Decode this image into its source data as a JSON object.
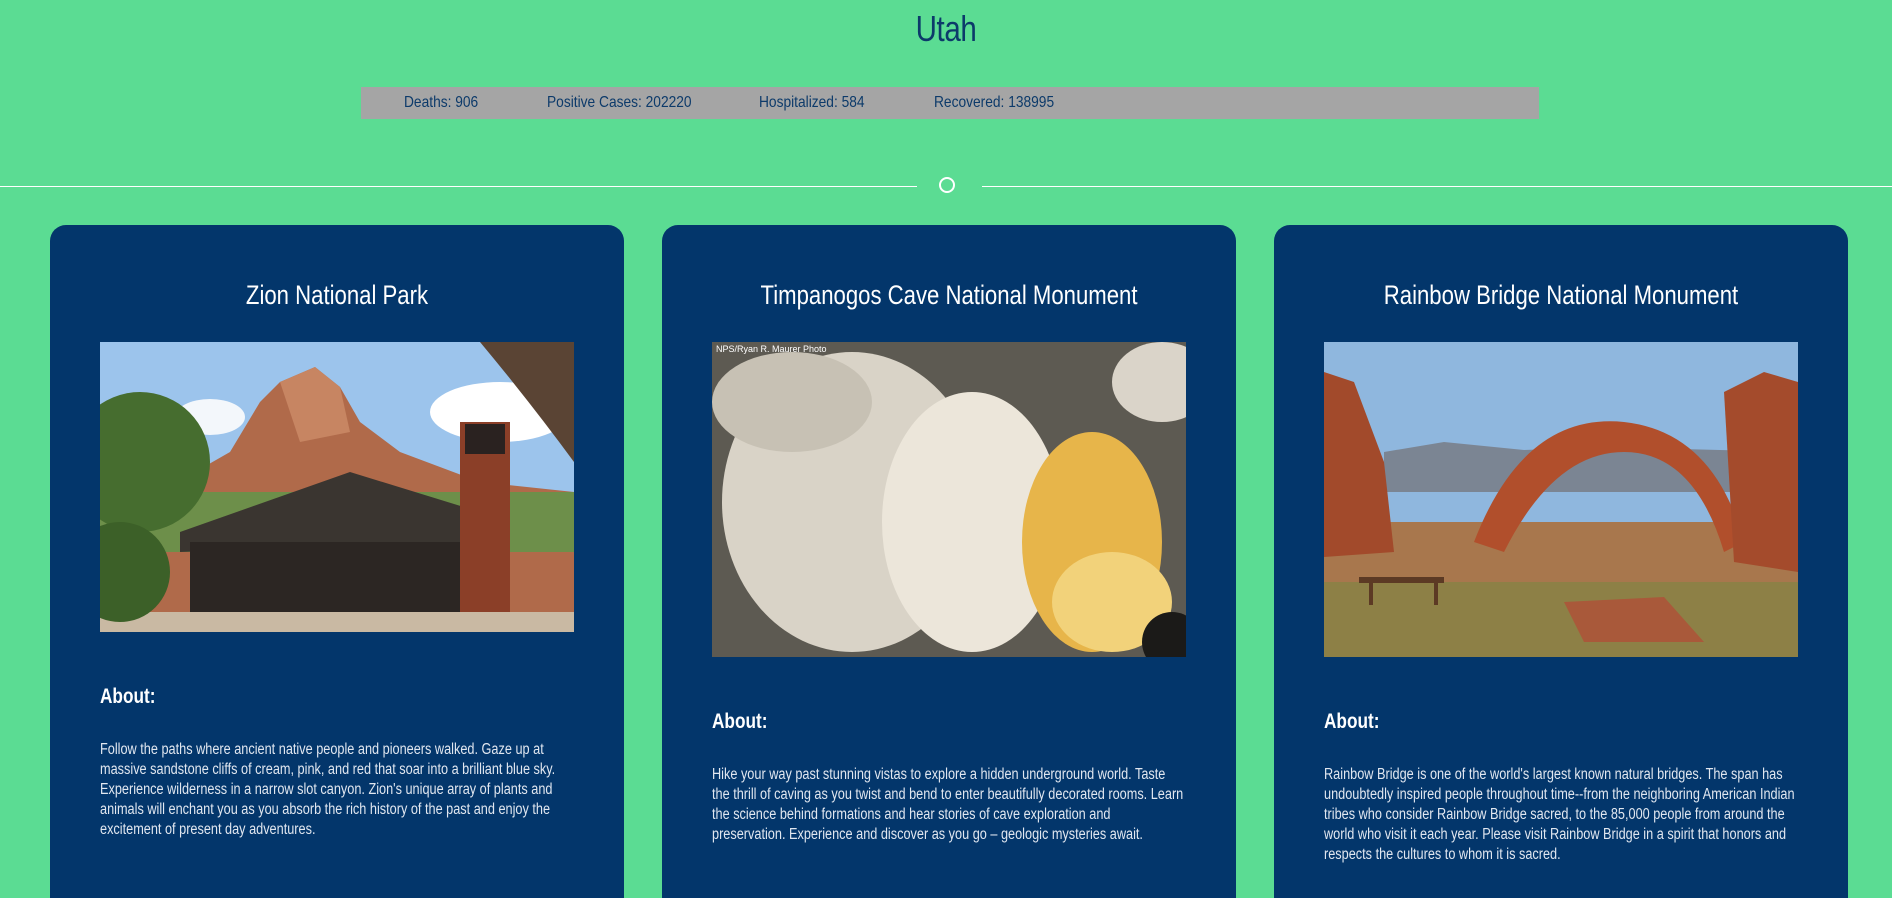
{
  "page": {
    "title": "Utah"
  },
  "stats": {
    "deaths": "Deaths: 906",
    "positive": "Positive Cases: 202220",
    "hospitalized": "Hospitalized: 584",
    "recovered": "Recovered: 138995"
  },
  "parks": [
    {
      "name": "Zion National Park",
      "about_label": "About:",
      "about": "Follow the paths where ancient native people and pioneers walked. Gaze up at massive sandstone cliffs of cream, pink, and red that soar into a brilliant blue sky. Experience wilderness in a narrow slot canyon. Zion's unique array of plants and animals will enchant you as you absorb the rich history of the past and enjoy the excitement of present day adventures.",
      "image_alt": "Zion visitor center with sandstone peak"
    },
    {
      "name": "Timpanogos Cave National Monument",
      "about_label": "About:",
      "about": "Hike your way past stunning vistas to explore a hidden underground world. Taste the thrill of caving as you twist and bend to enter beautifully decorated rooms. Learn the science behind formations and hear stories of cave exploration and preservation. Experience and discover as you go – geologic mysteries await.",
      "image_caption": "NPS/Ryan R. Maurer Photo"
    },
    {
      "name": "Rainbow Bridge National Monument",
      "about_label": "About:",
      "about": "Rainbow Bridge is one of the world's largest known natural bridges. The span has undoubtedly inspired people throughout time--from the neighboring American Indian tribes who consider Rainbow Bridge sacred, to the 85,000 people from around the world who visit it each year. Please visit Rainbow Bridge in a spirit that honors and respects the cultures to whom it is sacred."
    }
  ],
  "colors": {
    "background": "#5bdc93",
    "card": "#03366b",
    "stats_bar": "#a5a5a5",
    "title_text": "#0c3a6a"
  }
}
